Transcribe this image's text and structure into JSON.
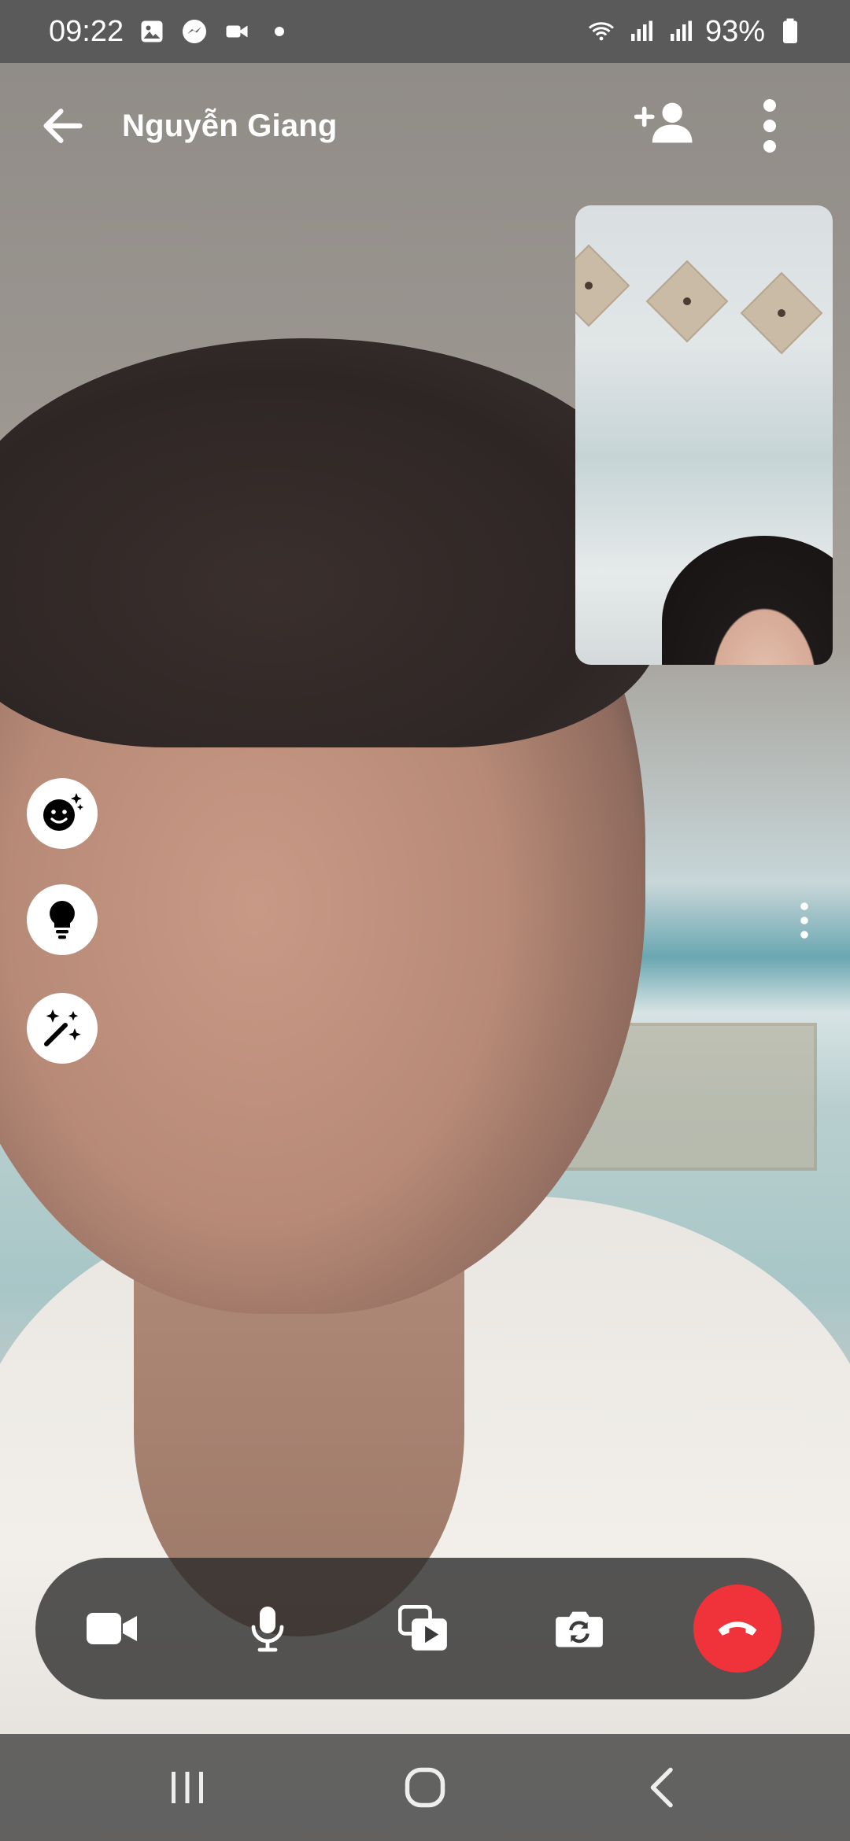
{
  "status_bar": {
    "time": "09:22",
    "notification_icons": [
      "gallery-icon",
      "messenger-icon",
      "video-icon",
      "dot-icon"
    ],
    "battery_percent": "93%"
  },
  "call": {
    "caller_name": "Nguyễn Giang"
  },
  "colors": {
    "end_call": "#f0323a",
    "control_bar": "#282828",
    "status_bar": "#5a5a5a"
  }
}
